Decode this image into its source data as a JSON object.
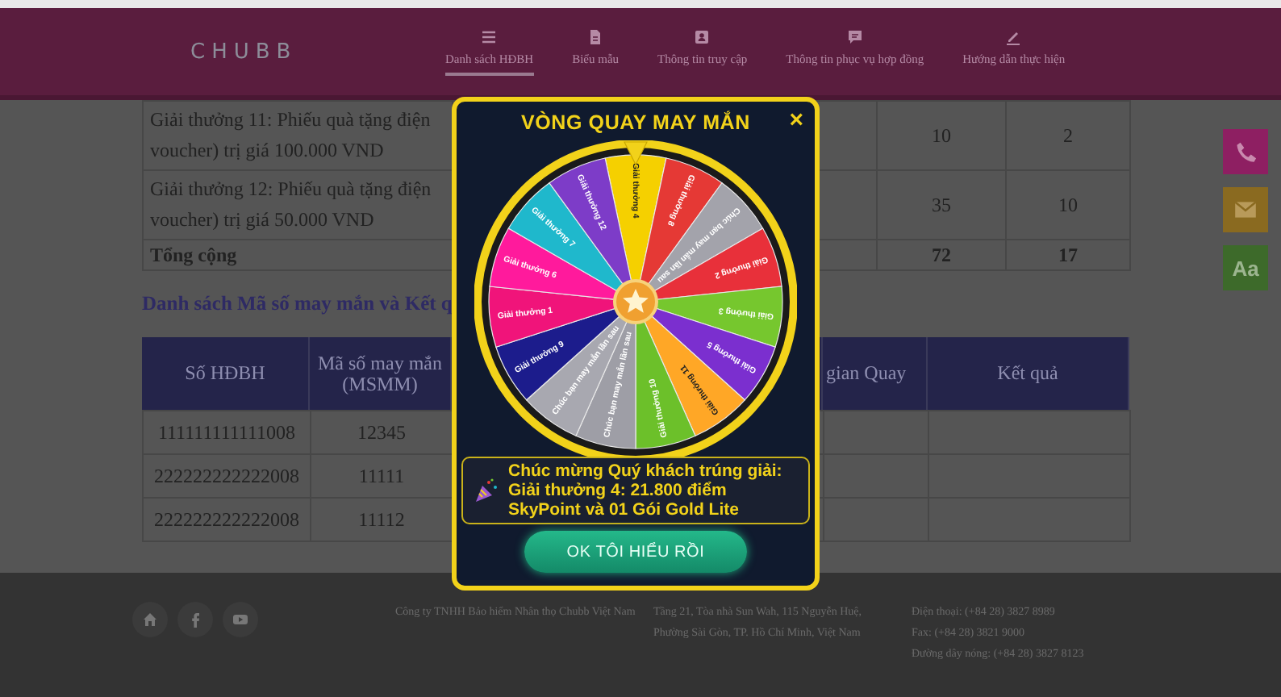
{
  "header": {
    "logo": "CHUBB",
    "nav": [
      {
        "label": "Danh sách HĐBH",
        "kind": "list",
        "selected": true
      },
      {
        "label": "Biểu mẫu",
        "kind": "document",
        "selected": false
      },
      {
        "label": "Thông tin truy cập",
        "kind": "id-card",
        "selected": false
      },
      {
        "label": "Thông tin phục vụ hợp đồng",
        "kind": "chat",
        "selected": false
      },
      {
        "label": "Hướng dẫn thực hiện",
        "kind": "pen",
        "selected": false
      }
    ]
  },
  "prize_table": {
    "rows": [
      {
        "label_lines": [
          "Giải thưởng 11: Phiếu quà tặng điện",
          "voucher) trị giá 100.000 VND"
        ],
        "column_3": "10",
        "column_4": "2",
        "kind": "prize"
      },
      {
        "label_lines": [
          "Giải thưởng 12: Phiếu quà tặng điện",
          "voucher) trị giá 50.000 VND"
        ],
        "column_3": "35",
        "column_4": "10",
        "kind": "prize"
      },
      {
        "label_lines": [
          "Tổng cộng"
        ],
        "column_3": "72",
        "column_4": "17",
        "kind": "total"
      }
    ]
  },
  "section_title": "Danh sách Mã số may mắn và Kết q",
  "result_table": {
    "columns": [
      "Số HĐBH",
      "Mã số may mắn (MSMM)",
      "gian Quay",
      "Kết quả"
    ],
    "rows": [
      {
        "policy": "111111111111008",
        "code": "12345"
      },
      {
        "policy": "222222222222008",
        "code": "11111"
      },
      {
        "policy": "222222222222008",
        "code": "11112"
      }
    ]
  },
  "side_buttons": [
    {
      "kind": "phone",
      "color": "#8e1f62"
    },
    {
      "kind": "mail",
      "color": "#8a6a20"
    },
    {
      "kind": "text",
      "label": "Aa",
      "color": "#3d6a2a"
    }
  ],
  "modal": {
    "title": "VÒNG QUAY MAY MẮN",
    "close": "×",
    "wheel": {
      "segments": [
        {
          "label": "Giải thưởng 4",
          "color": "#f5d000"
        },
        {
          "label": "Giải thưởng 8",
          "color": "#e53935"
        },
        {
          "label": "Chúc bạn may mắn lần sau",
          "color": "#a3a3ab"
        },
        {
          "label": "Giải thưởng 2",
          "color": "#e8303a"
        },
        {
          "label": "Giải thưởng 3",
          "color": "#76c72e"
        },
        {
          "label": "Giải thưởng 5",
          "color": "#7b2fcf"
        },
        {
          "label": "Giải thưởng 11",
          "color": "#ffa726"
        },
        {
          "label": "Giải thưởng 10",
          "color": "#6cc02a"
        },
        {
          "label": "Chúc bạn may mắn lần sau",
          "color": "#9e9ea6"
        },
        {
          "label": "Chúc bạn may mắn lần sau",
          "color": "#a8a8b0"
        },
        {
          "label": "Giải thưởng 9",
          "color": "#1c1c8c"
        },
        {
          "label": "Giải thưởng 1",
          "color": "#f0147a"
        },
        {
          "label": "Giải thưởng 6",
          "color": "#ff1a9c"
        },
        {
          "label": "Giải thưởng 7",
          "color": "#1fb8cc"
        },
        {
          "label": "Giải thưởng 12",
          "color": "#7d3cc8"
        }
      ]
    },
    "message_lines": [
      "Chúc mừng Quý khách trúng giải:",
      "Giải thưởng 4: 21.800 điểm",
      "SkyPoint và 01 Gói Gold Lite"
    ],
    "button": "OK TÔI HIỂU RỒI"
  },
  "footer": {
    "social": [
      {
        "kind": "home"
      },
      {
        "kind": "facebook"
      },
      {
        "kind": "youtube"
      }
    ],
    "company": "Công ty TNHH Bảo hiểm Nhân thọ Chubb Việt Nam",
    "address": "Tầng 21, Tòa nhà Sun Wah, 115 Nguyễn Huệ, Phường Sài Gòn, TP. Hồ Chí Minh, Việt Nam",
    "contacts": [
      "Điện thoại: (+84 28) 3827 8989",
      "Fax: (+84 28) 3821 9000",
      "Đường dây nóng: (+84 28) 3827 8123"
    ]
  }
}
